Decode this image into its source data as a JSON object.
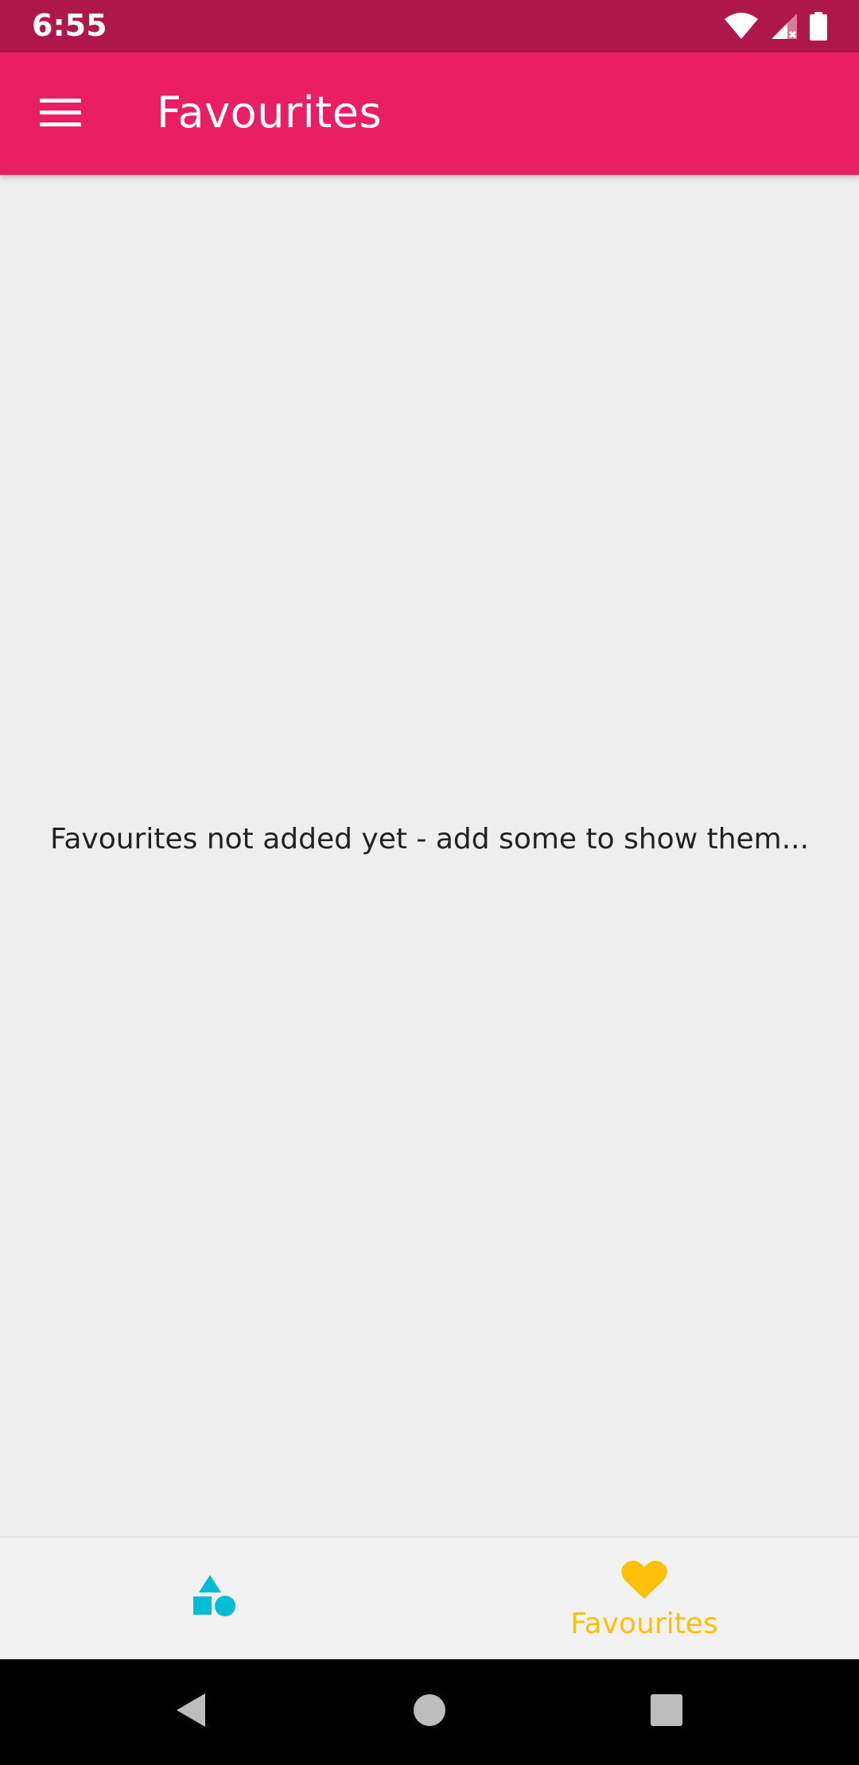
{
  "status_bar": {
    "time": "6:55",
    "icons": [
      "wifi-icon",
      "cell-signal-icon",
      "battery-icon"
    ]
  },
  "app_bar": {
    "menu_icon": "hamburger-menu-icon",
    "title": "Favourites",
    "background": "#e91e63"
  },
  "content": {
    "empty_message": "Favourites not added yet - add some to show them..."
  },
  "bottom_nav": {
    "tabs": [
      {
        "icon": "shapes-icon",
        "label": "",
        "color": "#00bcd4",
        "selected": false
      },
      {
        "icon": "heart-icon",
        "label": "Favourites",
        "color": "#ffc107",
        "selected": true
      }
    ]
  },
  "system_nav": {
    "buttons": [
      "back-icon",
      "home-icon",
      "recents-icon"
    ]
  },
  "colors": {
    "status_bar": "#ad1749",
    "accent": "#ffc107",
    "secondary": "#00bcd4"
  }
}
